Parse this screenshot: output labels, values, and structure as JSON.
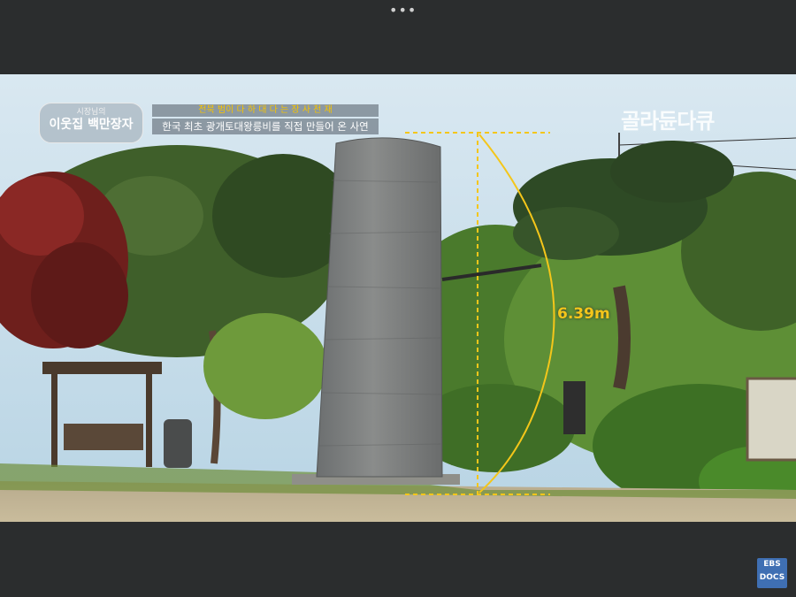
{
  "player": {
    "menu_icon": "more-dots-icon"
  },
  "overlay": {
    "badge_top": "시장님의",
    "badge_title": "이웃집 백만장자",
    "subtitle_line1": "전북 범이 다 하 대 다 는 장 사 천 재",
    "subtitle_line2": "한국 최초 광개토대왕릉비를 직접 만들어 온 사연",
    "channel_logo": "골라듄다큐",
    "measurement": "6.39m"
  },
  "watermark": {
    "line1": "EBS",
    "line2": "DOCS",
    "color": "#3f6fb3"
  },
  "colors": {
    "measure": "#f4c61a",
    "sky": "#cfe3ef",
    "stone": "#77797a"
  }
}
